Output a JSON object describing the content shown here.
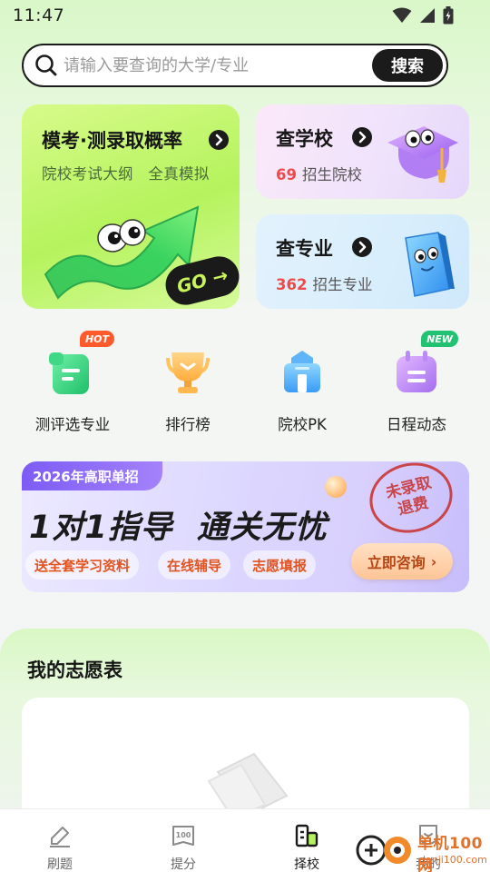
{
  "status_bar": {
    "time": "11:47"
  },
  "search": {
    "placeholder": "请输入要查询的大学/专业",
    "button_label": "搜索"
  },
  "feature_cards": {
    "mock": {
      "title": "模考·测录取概率",
      "subtitle": "院校考试大纲   全真模拟",
      "go_label": "GO"
    },
    "school": {
      "title": "查学校",
      "count": "69",
      "count_label": "招生院校"
    },
    "major": {
      "title": "查专业",
      "count": "362",
      "count_label": "招生专业"
    }
  },
  "quick_nav": [
    {
      "label": "测评选专业",
      "tag": "HOT",
      "icon": "evaluate-icon"
    },
    {
      "label": "排行榜",
      "icon": "trophy-icon"
    },
    {
      "label": "院校PK",
      "icon": "school-building-icon"
    },
    {
      "label": "日程动态",
      "tag": "NEW",
      "icon": "calendar-icon"
    }
  ],
  "banner": {
    "tag": "2026年高职单招",
    "headline_part1": "1对1指导",
    "headline_part2": "通关无忧",
    "chips": [
      "送全套学习资料",
      "在线辅导",
      "志愿填报"
    ],
    "cta": "立即咨询",
    "stamp_line1": "未录取",
    "stamp_line2": "退费"
  },
  "wishlist": {
    "title": "我的志愿表"
  },
  "bottom_nav": [
    {
      "label": "刷题",
      "icon": "practice-icon"
    },
    {
      "label": "提分",
      "icon": "score-icon"
    },
    {
      "label": "择校",
      "icon": "choose-school-icon",
      "active": true
    },
    {
      "label": "我的",
      "icon": "profile-icon"
    }
  ],
  "watermark": {
    "text": "单机100网",
    "url": "danji100.com"
  },
  "colors": {
    "accent_green": "#b5f35d",
    "dark": "#1b1b1b",
    "highlight_red": "#f0494a"
  }
}
